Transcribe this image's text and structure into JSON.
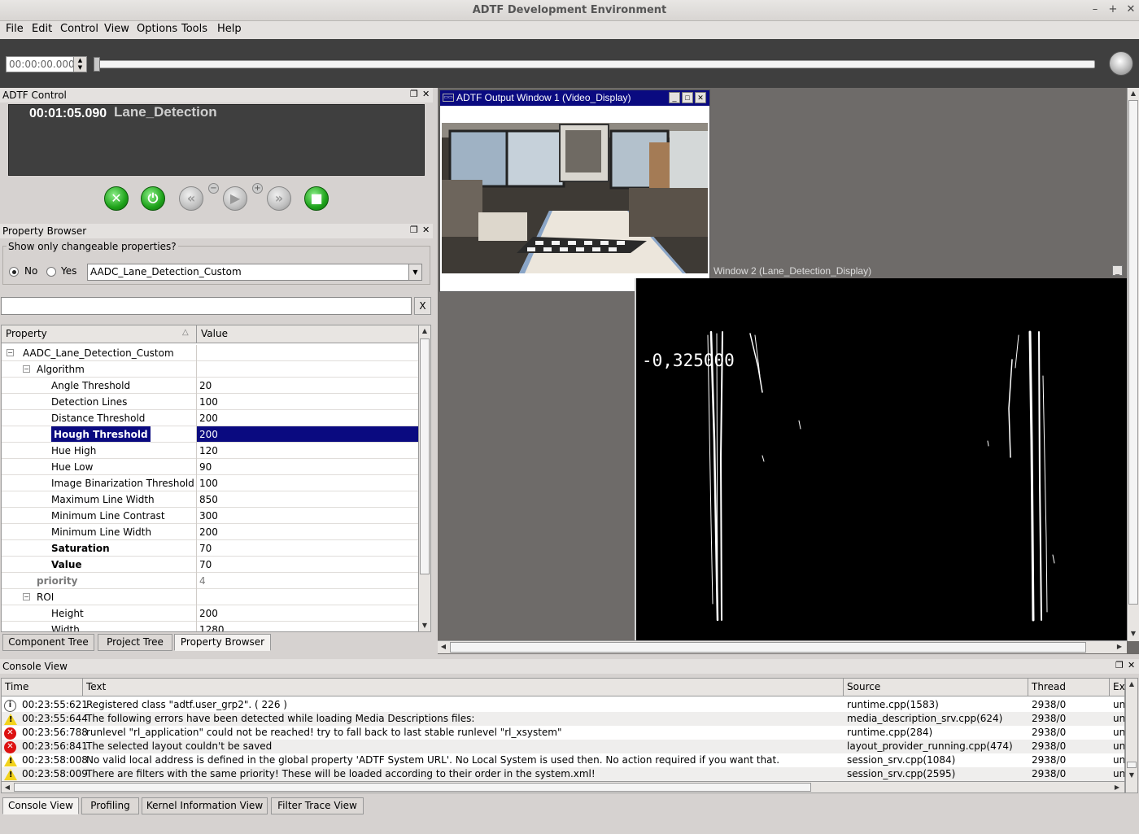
{
  "window": {
    "title": "ADTF Development Environment",
    "minimize": "–",
    "maximize": "+",
    "close": "✕"
  },
  "menu": [
    "File",
    "Edit",
    "Control",
    "View",
    "Options",
    "Tools",
    "Help"
  ],
  "timebar": {
    "time_value": "00:00:00.000",
    "slider_position": 0
  },
  "adtf_control": {
    "title": "ADTF Control",
    "elapsed": "00:01:05.090",
    "config_name": "Lane_Detection",
    "buttons": [
      "close",
      "power",
      "rewind",
      "play",
      "fast-forward",
      "stop"
    ],
    "minus": "−",
    "plus": "+"
  },
  "property_browser": {
    "title": "Property Browser",
    "changeable_label": "Show only changeable properties?",
    "radio_no": "No",
    "radio_yes": "Yes",
    "selected_radio": "No",
    "filter_combo": "AADC_Lane_Detection_Custom",
    "filter_clear": "X",
    "col_property": "Property",
    "col_value": "Value",
    "rows": [
      {
        "name": "AADC_Lane_Detection_Custom",
        "value": ""
      },
      {
        "name": "Algorithm",
        "value": ""
      },
      {
        "name": "Angle Threshold",
        "value": "20"
      },
      {
        "name": "Detection Lines",
        "value": "100"
      },
      {
        "name": "Distance Threshold",
        "value": "200"
      },
      {
        "name": "Hough Threshold",
        "value": "200"
      },
      {
        "name": "Hue High",
        "value": "120"
      },
      {
        "name": "Hue Low",
        "value": "90"
      },
      {
        "name": "Image Binarization Threshold",
        "value": "100"
      },
      {
        "name": "Maximum Line Width",
        "value": "850"
      },
      {
        "name": "Minimum Line Contrast",
        "value": "300"
      },
      {
        "name": "Minimum Line Width",
        "value": "200"
      },
      {
        "name": "Saturation",
        "value": "70"
      },
      {
        "name": "Value",
        "value": "70"
      },
      {
        "name": "priority",
        "value": "4"
      },
      {
        "name": "ROI",
        "value": ""
      },
      {
        "name": "Height",
        "value": "200"
      },
      {
        "name": "Width",
        "value": "1280"
      }
    ],
    "tabs": [
      "Component Tree",
      "Project Tree",
      "Property Browser"
    ],
    "active_tab": "Property Browser"
  },
  "output_window_1": {
    "title": "ADTF Output Window 1 (Video_Display)"
  },
  "output_window_2": {
    "title": "Window 2 (Lane_Detection_Display)",
    "overlay_value": "-0,325000"
  },
  "console": {
    "title": "Console View",
    "columns": [
      "Time",
      "Text",
      "Source",
      "Thread",
      "Ex"
    ],
    "rows": [
      {
        "type": "info",
        "time": "00:23:55:621",
        "text": "  Registered class \"adtf.user_grp2\". ( 226 )",
        "source": "runtime.cpp(1583)",
        "thread": "2938/0",
        "ex": "un"
      },
      {
        "type": "warning",
        "time": "00:23:55:644",
        "text": "The following errors have been detected while loading Media Descriptions files:",
        "source": "media_description_srv.cpp(624)",
        "thread": "2938/0",
        "ex": "un"
      },
      {
        "type": "error",
        "time": "00:23:56:788",
        "text": "runlevel \"rl_application\" could not be reached! try to fall back to last stable runlevel \"rl_xsystem\"",
        "source": "runtime.cpp(284)",
        "thread": "2938/0",
        "ex": "un"
      },
      {
        "type": "error",
        "time": "00:23:56:841",
        "text": "The selected layout couldn't be saved",
        "source": "layout_provider_running.cpp(474)",
        "thread": "2938/0",
        "ex": "un"
      },
      {
        "type": "warning",
        "time": "00:23:58:008",
        "text": "No valid local address is defined in the global property 'ADTF System URL'. No Local System is used then. No action required if you want that.",
        "source": "session_srv.cpp(1084)",
        "thread": "2938/0",
        "ex": "un"
      },
      {
        "type": "warning",
        "time": "00:23:58:009",
        "text": "There are filters with the same priority! These will be loaded according to their order in the system.xml!",
        "source": "session_srv.cpp(2595)",
        "thread": "2938/0",
        "ex": "un"
      }
    ],
    "tabs": [
      "Console View",
      "Profiling",
      "Kernel Information View",
      "Filter Trace View"
    ],
    "active_tab": "Console View"
  },
  "colors": {
    "selection": "#0a0a80",
    "dark_panel": "#3f3f3f",
    "mdi_background": "#6e6b69",
    "warning": "#f3d31d",
    "error": "#dd1111"
  }
}
